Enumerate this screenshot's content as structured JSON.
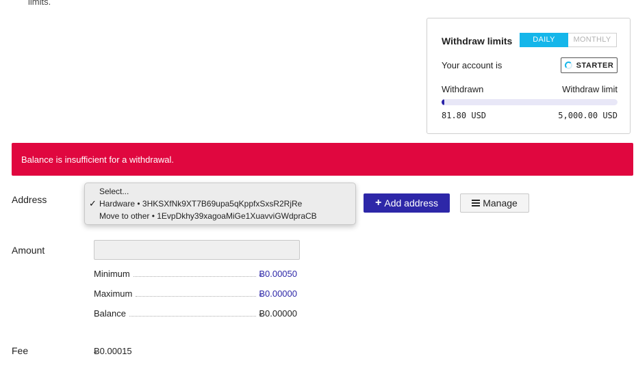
{
  "top_text": "limits.",
  "limits": {
    "title": "Withdraw limits",
    "periods": [
      {
        "label": "DAILY",
        "active": true
      },
      {
        "label": "MONTHLY",
        "active": false
      }
    ],
    "account_label": "Your account is",
    "tier": "STARTER",
    "withdrawn_label": "Withdrawn",
    "limit_label": "Withdraw limit",
    "withdrawn_value": "81.80 USD",
    "limit_value": "5,000.00 USD",
    "progress_fraction": 0.0164,
    "progress_color": "#2a23a8",
    "accent_color": "#15b6ea"
  },
  "error": {
    "message": "Balance is insufficient for a withdrawal.",
    "color": "#e0073f"
  },
  "form": {
    "address_label": "Address",
    "amount_label": "Amount",
    "fee_label": "Fee",
    "address_options": [
      {
        "label": "Select...",
        "selected": false
      },
      {
        "label": "Hardware • 3HKSXfNk9XT7B69upa5qKppfxSxsR2RjRe",
        "selected": true
      },
      {
        "label": "Move to other • 1EvpDkhy39xagoaMiGe1XuavviGWdpraCB",
        "selected": false
      }
    ],
    "check_glyph": "✓",
    "add_address_label": "Add address",
    "manage_label": "Manage",
    "amount_value": "",
    "minimum_label": "Minimum",
    "minimum_value": "Ƀ0.00050",
    "maximum_label": "Maximum",
    "maximum_value": "Ƀ0.00000",
    "balance_label": "Balance",
    "balance_value": "Ƀ0.00000",
    "fee_value": "Ƀ0.00015"
  },
  "icons": {
    "add": "plus-icon",
    "manage": "list-icon",
    "tier": "spinner-icon"
  }
}
